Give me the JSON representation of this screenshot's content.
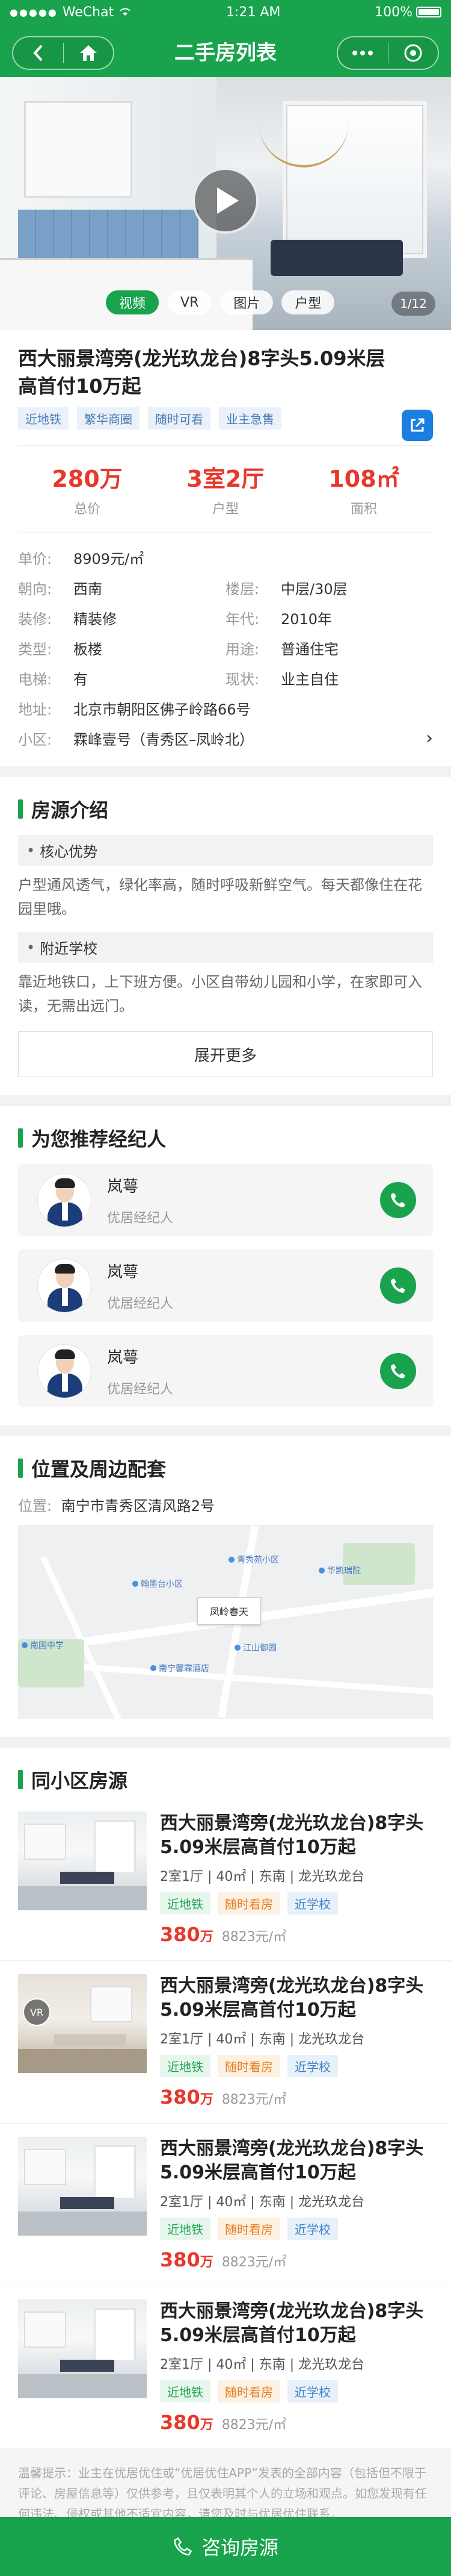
{
  "status": {
    "carrier": "WeChat",
    "time": "1:21 AM",
    "battery": "100%"
  },
  "nav": {
    "title": "二手房列表"
  },
  "hero": {
    "tabs": [
      {
        "label": "视频",
        "active": true
      },
      {
        "label": "VR",
        "active": false
      },
      {
        "label": "图片",
        "active": false
      },
      {
        "label": "户型",
        "active": false
      }
    ],
    "pager": "1/12"
  },
  "house": {
    "title": "西大丽景湾旁(龙光玖龙台)8字头5.09米层高首付10万起",
    "tags": [
      "近地铁",
      "繁华商圈",
      "随时可看",
      "业主急售"
    ],
    "stats": [
      {
        "value": "280万",
        "label": "总价"
      },
      {
        "value": "3室2厅",
        "label": "户型"
      },
      {
        "value": "108㎡",
        "label": "面积"
      }
    ],
    "unit_price_label": "单价:",
    "unit_price": "8909元/㎡",
    "info": [
      [
        {
          "k": "朝向:",
          "v": "西南"
        },
        {
          "k": "楼层:",
          "v": "中层/30层"
        }
      ],
      [
        {
          "k": "装修:",
          "v": "精装修"
        },
        {
          "k": "年代:",
          "v": "2010年"
        }
      ],
      [
        {
          "k": "类型:",
          "v": "板楼"
        },
        {
          "k": "用途:",
          "v": "普通住宅"
        }
      ],
      [
        {
          "k": "电梯:",
          "v": "有"
        },
        {
          "k": "现状:",
          "v": "业主自住"
        }
      ]
    ],
    "address_label": "地址:",
    "address": "北京市朝阳区佛子岭路66号",
    "community_label": "小区:",
    "community": "霖峰壹号（青秀区–凤岭北）"
  },
  "intro": {
    "title": "房源介绍",
    "sections": [
      {
        "label": "核心优势",
        "text": "户型通风透气，绿化率高，随时呼吸新鲜空气。每天都像住在花园里哦。"
      },
      {
        "label": "附近学校",
        "text": "靠近地铁口，上下班方便。小区自带幼儿园和小学，在家即可入读，无需出远门。"
      }
    ],
    "more": "展开更多"
  },
  "agents": {
    "title": "为您推荐经纪人",
    "items": [
      {
        "name": "岚萼",
        "role": "优居经纪人"
      },
      {
        "name": "岚萼",
        "role": "优居经纪人"
      },
      {
        "name": "岚萼",
        "role": "优居经纪人"
      }
    ]
  },
  "location": {
    "title": "位置及周边配套",
    "label": "位置:",
    "address": "南宁市青秀区清风路2号",
    "map_labels": {
      "center": "凤岭春天",
      "poi1": "青秀苑小区",
      "poi2": "华凯瑞院",
      "poi3": "翰墨台小区",
      "poi4": "江山御园",
      "poi5": "南国中学",
      "poi6": "南宁馨霖酒店"
    }
  },
  "same": {
    "title": "同小区房源",
    "items": [
      {
        "title": "西大丽景湾旁(龙光玖龙台)8字头5.09米层高首付10万起",
        "meta": "2室1厅 | 40㎡ | 东南 | 龙光玖龙台",
        "tags": [
          "近地铁",
          "随时看房",
          "近学校"
        ],
        "price": "380",
        "price_unit": "万",
        "unit_price": "8823元/㎡",
        "vr": false
      },
      {
        "title": "西大丽景湾旁(龙光玖龙台)8字头5.09米层高首付10万起",
        "meta": "2室1厅 | 40㎡ | 东南 | 龙光玖龙台",
        "tags": [
          "近地铁",
          "随时看房",
          "近学校"
        ],
        "price": "380",
        "price_unit": "万",
        "unit_price": "8823元/㎡",
        "vr": true
      },
      {
        "title": "西大丽景湾旁(龙光玖龙台)8字头5.09米层高首付10万起",
        "meta": "2室1厅 | 40㎡ | 东南 | 龙光玖龙台",
        "tags": [
          "近地铁",
          "随时看房",
          "近学校"
        ],
        "price": "380",
        "price_unit": "万",
        "unit_price": "8823元/㎡",
        "vr": false
      },
      {
        "title": "西大丽景湾旁(龙光玖龙台)8字头5.09米层高首付10万起",
        "meta": "2室1厅 | 40㎡ | 东南 | 龙光玖龙台",
        "tags": [
          "近地铁",
          "随时看房",
          "近学校"
        ],
        "price": "380",
        "price_unit": "万",
        "unit_price": "8823元/㎡",
        "vr": false
      }
    ]
  },
  "notice": "温馨提示：业主在优居优住或“优居优住APP”发表的全部内容（包括但不限于评论、房屋信息等）仅供参考，且仅表明其个人的立场和观点。如您发现有任何违法、侵权或其他不适宜内容，请您及时与优居优住联系。",
  "bottom": {
    "label": "咨询房源"
  },
  "colors": {
    "brand": "#19a34d",
    "price": "#e8382c",
    "share": "#1a7fe0"
  }
}
